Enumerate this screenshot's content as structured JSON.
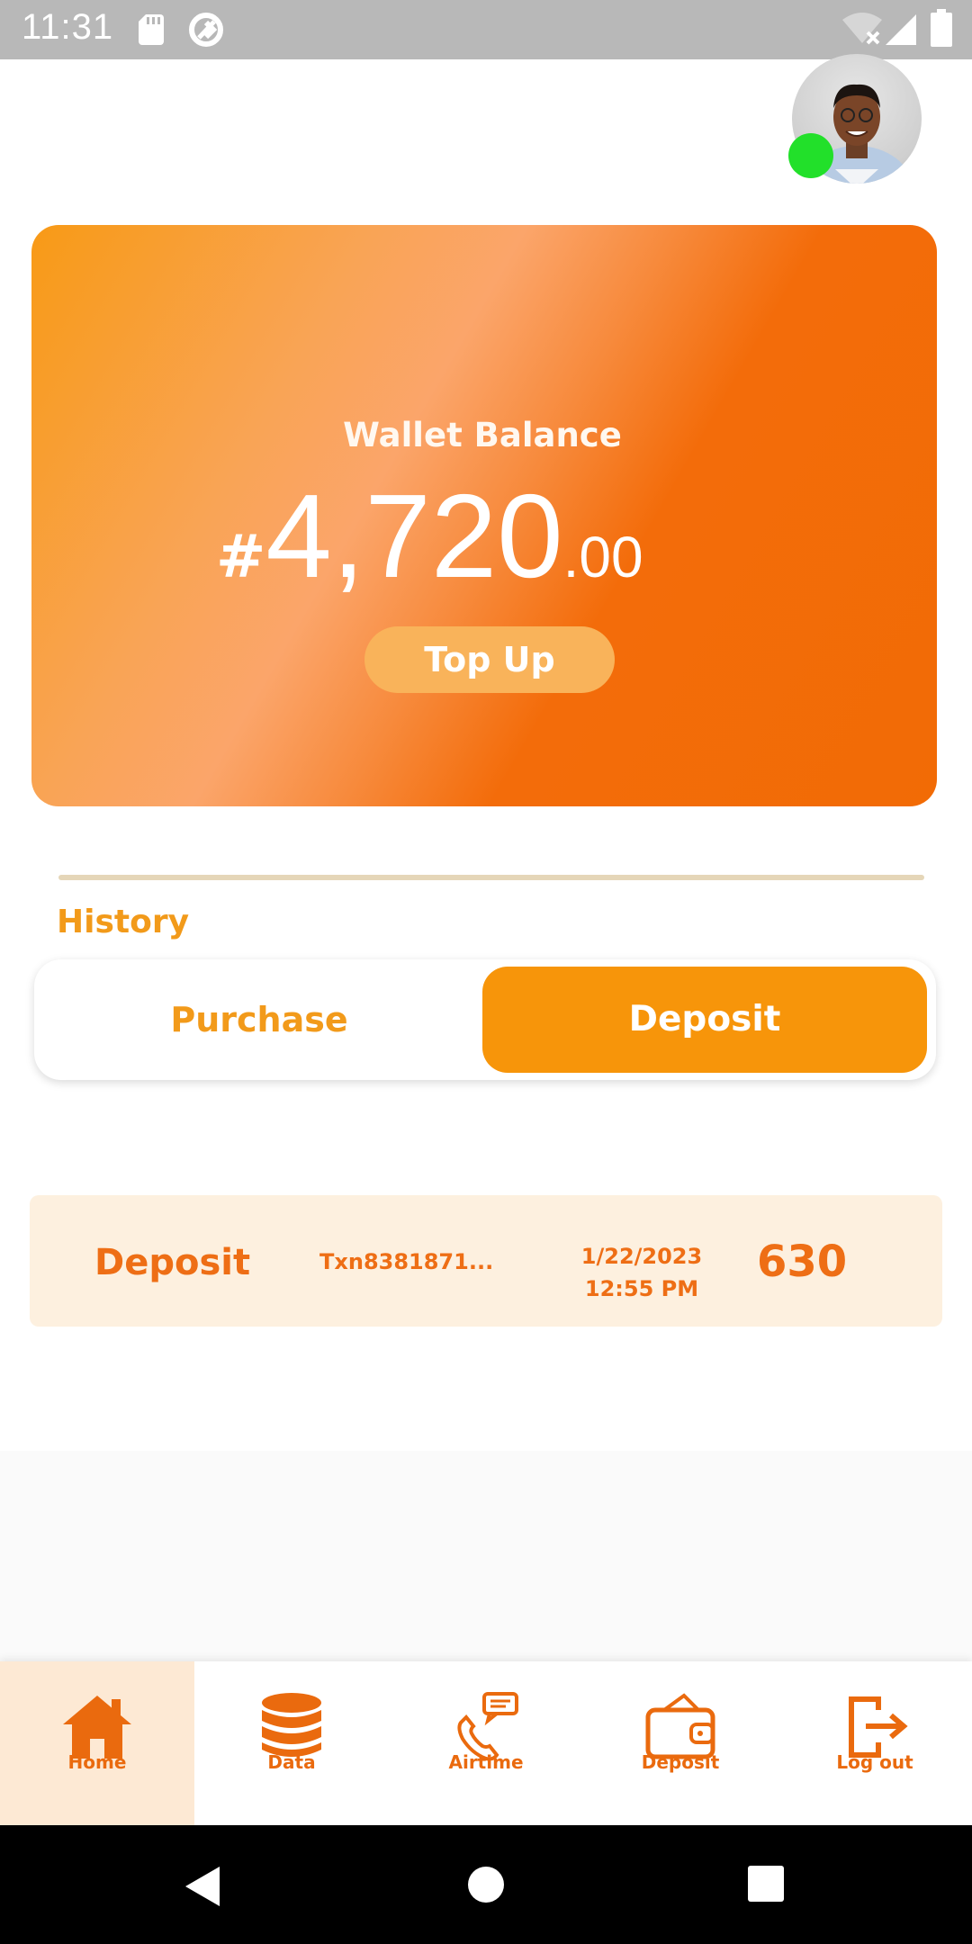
{
  "status_bar": {
    "time": "11:31"
  },
  "profile": {
    "avatar_icon": "person-avatar",
    "online_color": "#22e02a"
  },
  "wallet": {
    "label": "Wallet Balance",
    "currency": "#",
    "amount_integer": "4,720",
    "amount_decimal": ".00",
    "topup_label": "Top Up"
  },
  "history": {
    "title": "History",
    "tabs": [
      {
        "label": "Purchase",
        "selected": false
      },
      {
        "label": "Deposit",
        "selected": true
      }
    ],
    "transactions": [
      {
        "type": "Deposit",
        "txn_id": "Txn8381871...",
        "date": "1/22/2023",
        "time": "12:55 PM",
        "amount": "630"
      }
    ]
  },
  "bottom_nav": {
    "items": [
      {
        "label": "Home",
        "icon": "home-icon",
        "active": true
      },
      {
        "label": "Data",
        "icon": "database-icon",
        "active": false
      },
      {
        "label": "Airtime",
        "icon": "phone-chat-icon",
        "active": false
      },
      {
        "label": "Deposit",
        "icon": "wallet-icon",
        "active": false
      },
      {
        "label": "Log out",
        "icon": "logout-icon",
        "active": false
      }
    ]
  },
  "colors": {
    "accent": "#f7950a",
    "text_orange": "#ee6e15",
    "card_start": "#f89a16",
    "card_end": "#f26b05",
    "row_bg": "#fdf0df"
  }
}
